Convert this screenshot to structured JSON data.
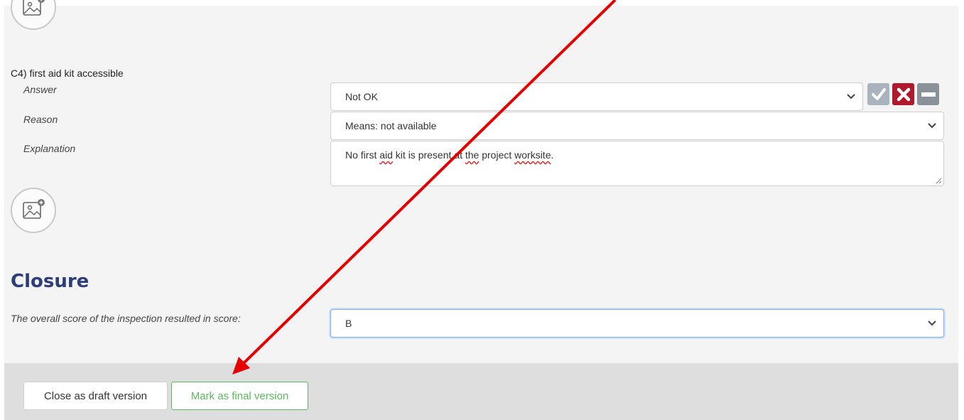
{
  "question": {
    "title": "C4) first aid kit accessible",
    "answer_label": "Answer",
    "answer_value": "Not OK",
    "reason_label": "Reason",
    "reason_value": "Means: not available",
    "explanation_label": "Explanation",
    "explanation_parts": [
      "No first ",
      "aid",
      " kit is present at ",
      "the",
      " project ",
      "worksite",
      "."
    ]
  },
  "answer_buttons": {
    "ok_color": "#a9b3be",
    "notok_color": "#b0182c",
    "na_color": "#8a9199"
  },
  "closure": {
    "heading": "Closure",
    "score_label": "The overall score of the inspection resulted in score:",
    "score_value": "B"
  },
  "footer": {
    "draft_label": "Close as draft version",
    "final_label": "Mark as final version",
    "final_color": "#5cb85c"
  },
  "annotation": {
    "arrow_color": "#e60000"
  },
  "icons": {
    "photo_add": "image-plus-icon",
    "chevron": "chevron-down-icon"
  }
}
